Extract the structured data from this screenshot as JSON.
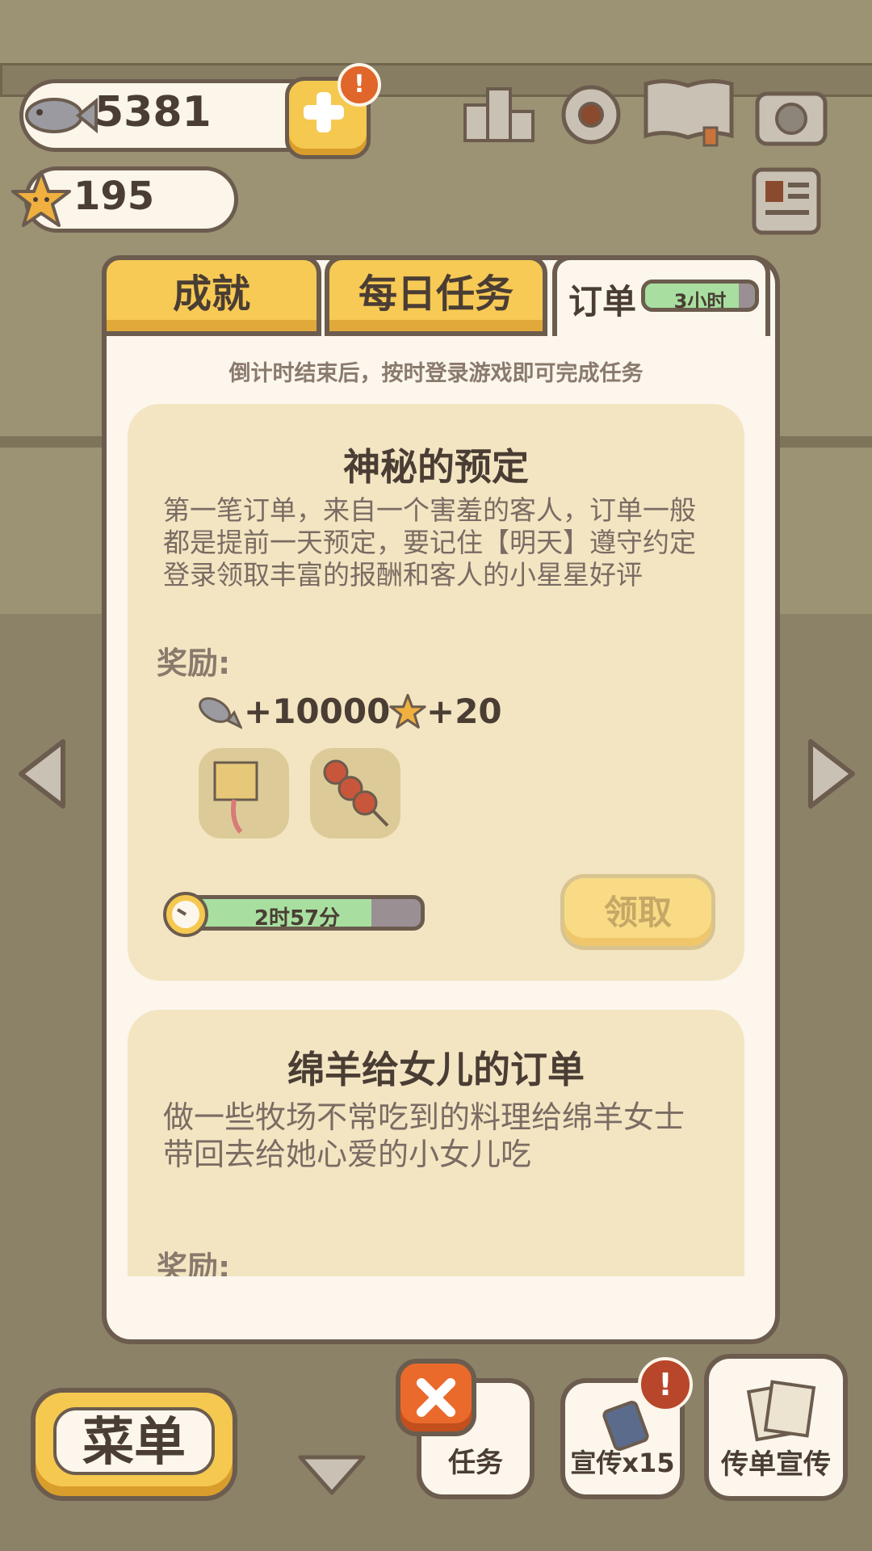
{
  "currency": {
    "fish": "5381",
    "stars": "195"
  },
  "top_icons": [
    "ranking-icon",
    "settings-icon",
    "book-icon",
    "camera-icon",
    "newspaper-icon"
  ],
  "tabs": {
    "achievements": "成就",
    "daily": "每日任务",
    "orders": "订单",
    "orders_timer": "3小时",
    "orders_timer_progress": 0.85
  },
  "hint": "倒计时结束后，按时登录游戏即可完成任务",
  "orders": [
    {
      "title": "神秘的预定",
      "description": "第一笔订单，来自一个害羞的客人，订单一般都是提前一天预定，要记住【明天】遵守约定登录领取丰富的报酬和客人的小星星好评",
      "reward_label": "奖励:",
      "reward_fish": "+10000",
      "reward_stars": "+20",
      "reward_items": [
        "bag-on-stick-icon",
        "meatball-skewer-icon"
      ],
      "timer": "2时57分",
      "timer_progress": 0.8,
      "claim_label": "领取"
    },
    {
      "title": "绵羊给女儿的订单",
      "description": "做一些牧场不常吃到的料理给绵羊女士带回去给她心爱的小女儿吃",
      "reward_label": "奖励:"
    }
  ],
  "bottom": {
    "menu": "菜单",
    "tasks": "任务",
    "promo": "宣传x15",
    "flyer": "传单宣传"
  },
  "colors": {
    "panel_bg": "#fcf6ec",
    "tab_yellow": "#f7ca55",
    "card_bg": "#f3e5c2",
    "outline": "#6b5c4e",
    "progress_green": "#a8dfa0",
    "alert_orange": "#e0662a"
  }
}
